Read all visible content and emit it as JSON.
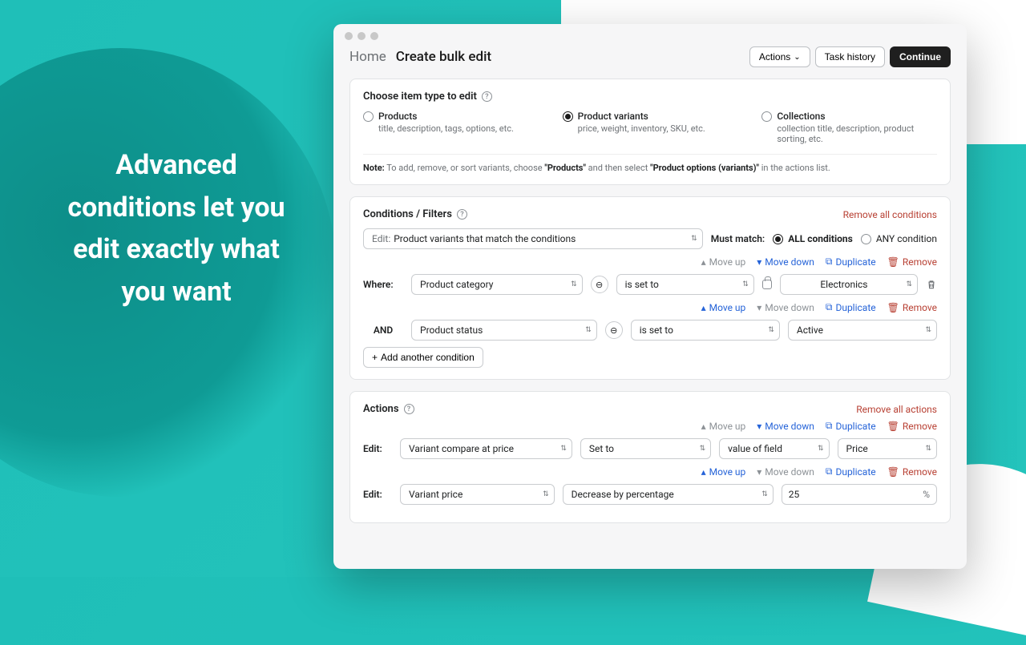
{
  "headline": "Advanced conditions let you edit exactly what you want",
  "breadcrumb": {
    "home": "Home",
    "page": "Create bulk edit"
  },
  "topbar": {
    "actions": "Actions",
    "task_history": "Task history",
    "continue": "Continue"
  },
  "item_type_section": {
    "title": "Choose item type to edit",
    "options": [
      {
        "label": "Products",
        "desc": "title, description, tags, options, etc.",
        "checked": false
      },
      {
        "label": "Product variants",
        "desc": "price, weight, inventory, SKU, etc.",
        "checked": true
      },
      {
        "label": "Collections",
        "desc": "collection title, description, product sorting, etc.",
        "checked": false
      }
    ],
    "note_label": "Note:",
    "note_text_1": " To add, remove, or sort variants, choose ",
    "note_strong_1": "\"Products\"",
    "note_text_2": " and then select ",
    "note_strong_2": "\"Product options (variants)\"",
    "note_text_3": " in the actions list."
  },
  "conditions": {
    "title": "Conditions / Filters",
    "remove_all": "Remove all conditions",
    "edit_label": "Edit:",
    "edit_value": "Product variants that match the conditions",
    "must_match": "Must match:",
    "all": "ALL conditions",
    "any": "ANY condition",
    "row_actions": {
      "move_up": "Move up",
      "move_down": "Move down",
      "duplicate": "Duplicate",
      "remove": "Remove"
    },
    "rows": [
      {
        "prefix": "Where:",
        "field": "Product category",
        "op": "is set to",
        "value": "Electronics",
        "has_lock": true,
        "has_trash": true,
        "up_enabled": false,
        "down_enabled": true
      },
      {
        "prefix": "AND",
        "field": "Product status",
        "op": "is set to",
        "value": "Active",
        "has_lock": false,
        "has_trash": false,
        "up_enabled": true,
        "down_enabled": false
      }
    ],
    "add": "Add another condition"
  },
  "actions_section": {
    "title": "Actions",
    "remove_all": "Remove all actions",
    "row_actions": {
      "move_up": "Move up",
      "move_down": "Move down",
      "duplicate": "Duplicate",
      "remove": "Remove"
    },
    "rows": [
      {
        "prefix": "Edit:",
        "selects": [
          "Variant compare at price",
          "Set to",
          "value of field",
          "Price"
        ],
        "up_enabled": false,
        "down_enabled": true
      },
      {
        "prefix": "Edit:",
        "selects": [
          "Variant price",
          "Decrease by percentage"
        ],
        "input_value": "25",
        "input_suffix": "%",
        "up_enabled": true,
        "down_enabled": false
      }
    ]
  }
}
